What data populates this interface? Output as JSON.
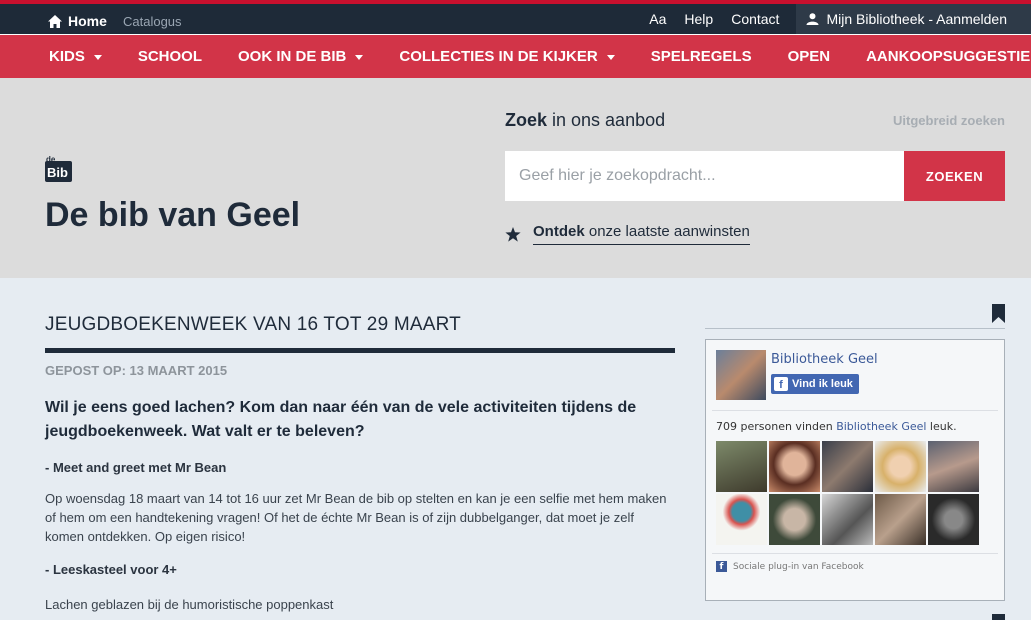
{
  "topbar": {
    "home_label": "Home",
    "catalogus_label": "Catalogus",
    "links": [
      "Aa",
      "Help",
      "Contact"
    ],
    "account_label": "Mijn Bibliotheek - Aanmelden"
  },
  "nav": {
    "items": [
      {
        "label": "KIDS",
        "dropdown": true
      },
      {
        "label": "SCHOOL",
        "dropdown": false
      },
      {
        "label": "OOK IN DE BIB",
        "dropdown": true
      },
      {
        "label": "COLLECTIES IN DE KIJKER",
        "dropdown": true
      },
      {
        "label": "SPELREGELS",
        "dropdown": false
      },
      {
        "label": "OPEN",
        "dropdown": false
      },
      {
        "label": "AANKOOPSUGGESTIE",
        "dropdown": false
      }
    ]
  },
  "hero": {
    "logo_top": "de",
    "logo_bottom": "Bib",
    "library_name": "De bib van Geel",
    "search_title_bold": "Zoek",
    "search_title_rest": " in ons aanbod",
    "advanced_search": "Uitgebreid zoeken",
    "search_placeholder": "Geef hier je zoekopdracht...",
    "search_button": "ZOEKEN",
    "discover_bold": "Ontdek",
    "discover_rest": " onze laatste aanwinsten"
  },
  "article": {
    "title": "JEUGDBOEKENWEEK VAN 16 TOT 29 MAART",
    "date": "GEPOST OP: 13 MAART 2015",
    "lead": "Wil je eens goed lachen? Kom dan naar één van de vele activiteiten tijdens de jeugdboekenweek. Wat valt er te beleven?",
    "heading1": "- Meet and greet met Mr Bean",
    "para1": "Op woensdag 18 maart van 14 tot 16 uur zet Mr Bean de bib op stelten en kan je een selfie met hem maken of hem om een handtekening vragen! Of het de échte Mr Bean is of zijn dubbelganger, dat moet je zelf komen ontdekken. Op eigen risico!",
    "heading2": "- Leeskasteel voor 4+",
    "para2": "Lachen geblazen bij de humoristische poppenkast"
  },
  "facebook": {
    "page_name": "Bibliotheek Geel",
    "like_button": "Vind ik leuk",
    "like_count_prefix": "709 personen vinden ",
    "like_count_page": "Bibliotheek Geel",
    "like_count_suffix": " leuk.",
    "plugin_text": "Sociale plug-in van Facebook"
  },
  "colors": {
    "brand_red": "#d23448",
    "dark_navy": "#1e2a38",
    "hero_gray": "#dcdcdc",
    "page_bg": "#e6ecf2",
    "facebook_blue": "#4267b2"
  }
}
